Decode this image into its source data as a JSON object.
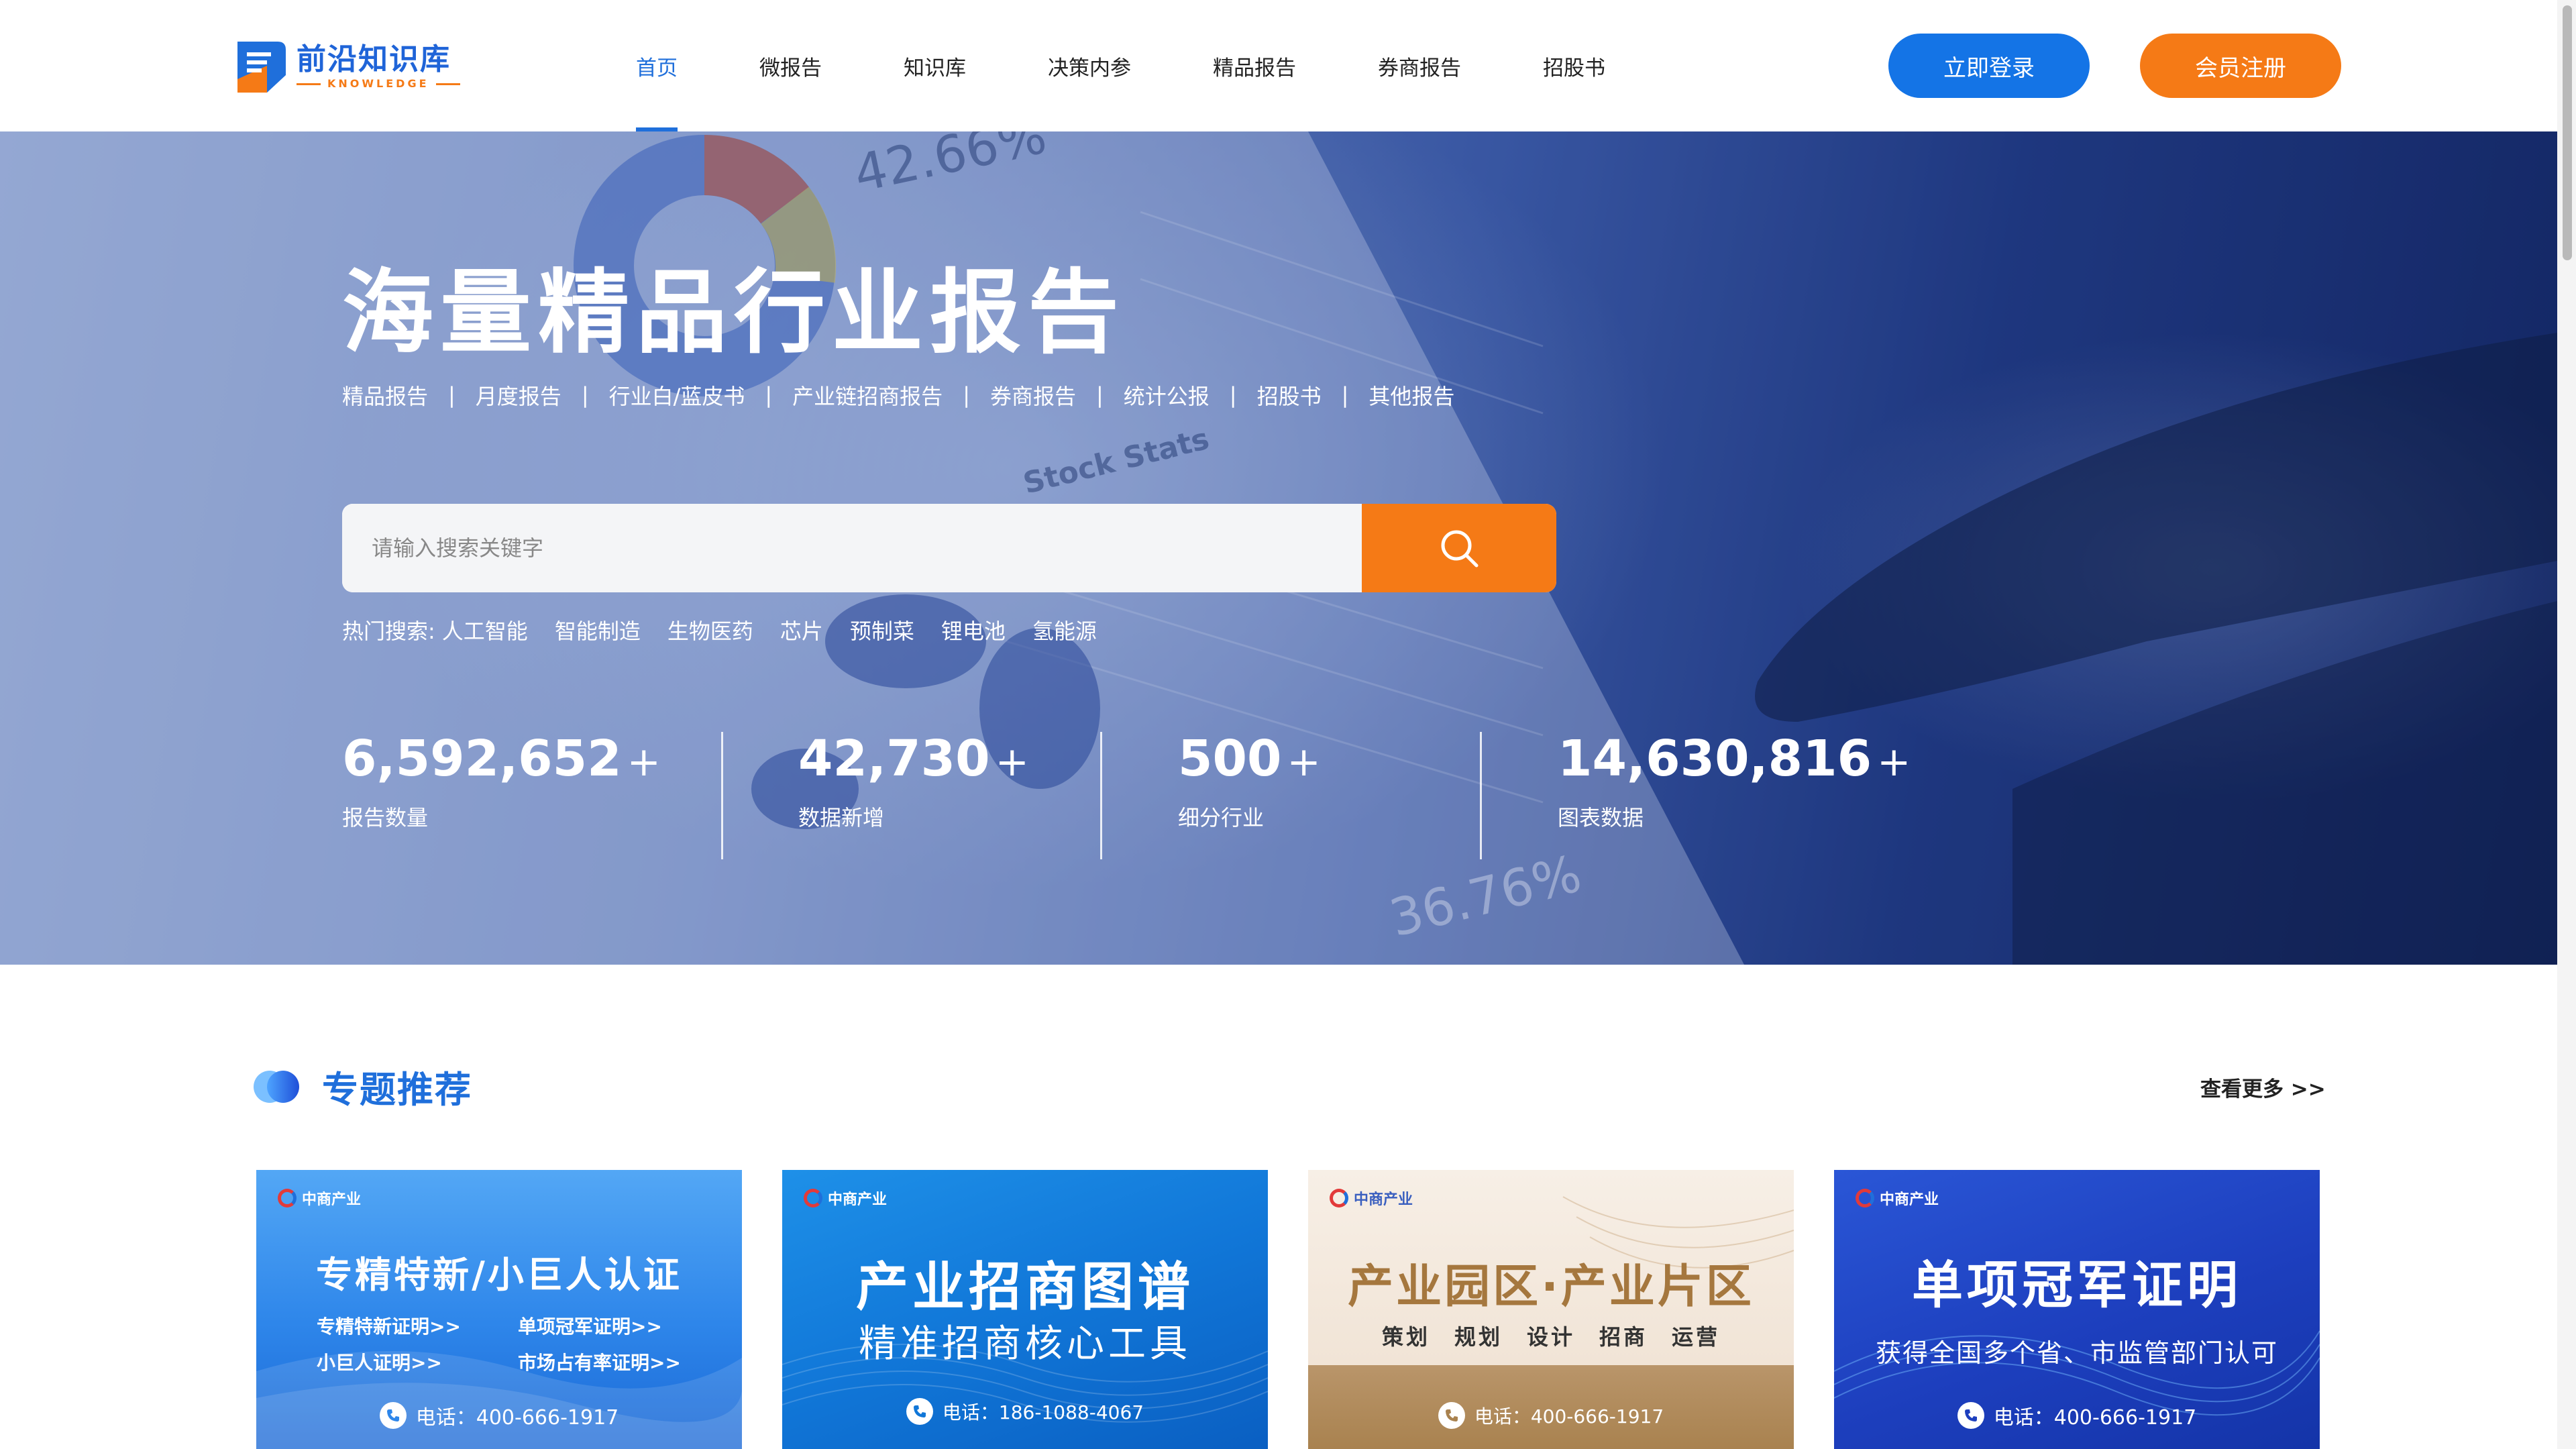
{
  "header": {
    "logo": {
      "cn": "前沿知识库",
      "en": "KNOWLEDGE"
    },
    "nav": [
      "首页",
      "微报告",
      "知识库",
      "决策内参",
      "精品报告",
      "券商报告",
      "招股书"
    ],
    "login_label": "立即登录",
    "register_label": "会员注册"
  },
  "hero": {
    "title": "海量精品行业报告",
    "categories": [
      "精品报告",
      "月度报告",
      "行业白/蓝皮书",
      "产业链招商报告",
      "券商报告",
      "统计公报",
      "招股书",
      "其他报告"
    ],
    "separator": "|",
    "search": {
      "placeholder": "请输入搜索关键字"
    },
    "hot_label": "热门搜索:",
    "hot_items": [
      "人工智能",
      "智能制造",
      "生物医药",
      "芯片",
      "预制菜",
      "锂电池",
      "氢能源"
    ],
    "bg_texts": {
      "t1": "42.66%",
      "t2": "Stock Stats",
      "t3": "36.76%"
    },
    "stats": [
      {
        "value": "6,592,652",
        "suffix": "+",
        "label": "报告数量"
      },
      {
        "value": "42,730",
        "suffix": "+",
        "label": "数据新增"
      },
      {
        "value": "500",
        "suffix": "+",
        "label": "细分行业"
      },
      {
        "value": "14,630,816",
        "suffix": "+",
        "label": "图表数据"
      }
    ]
  },
  "section": {
    "title": "专题推荐",
    "more_label": "查看更多 >>"
  },
  "cards": [
    {
      "logo": "中商产业",
      "title": "专精特新/小巨人认证",
      "links": [
        "专精特新证明>>",
        "单项冠军证明>>",
        "小巨人证明>>",
        "市场占有率证明>>"
      ],
      "phone": "电话：400-666-1917"
    },
    {
      "logo": "中商产业",
      "title": "产业招商图谱",
      "subtitle": "精准招商核心工具",
      "phone": "电话：186-1088-4067"
    },
    {
      "logo": "中商产业",
      "title": "产业园区·产业片区",
      "subtitle": "策划　规划　设计　招商　运营",
      "phone": "电话：400-666-1917"
    },
    {
      "logo": "中商产业",
      "title": "单项冠军证明",
      "subtitle": "获得全国多个省、市监管部门认可",
      "phone": "电话：400-666-1917"
    }
  ],
  "colors": {
    "brand_blue": "#1F6FDB",
    "login_blue": "#1474E6",
    "accent_orange": "#F57A16"
  }
}
